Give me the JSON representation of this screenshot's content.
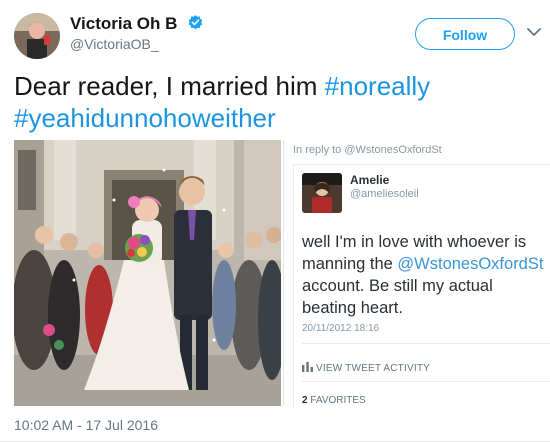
{
  "author": {
    "name": "Victoria Oh B",
    "handle": "@VictoriaOB_"
  },
  "follow_label": "Follow",
  "tweet": {
    "text_prefix": "Dear reader, I married him ",
    "hashtag1": "#noreally",
    "hashtag2": "#yeahidunnohoweither",
    "timestamp": "10:02 AM - 17 Jul 2016"
  },
  "reply": {
    "in_reply_to": "In reply to @WstonesOxfordSt",
    "name": "Amelie",
    "handle": "@ameliesoleil",
    "text_1": "well I'm in love with whoever is manning the ",
    "mention": "@WstonesOxfordSt",
    "text_2": " account. Be still my actual beating heart.",
    "date": "20/11/2012 18:16",
    "activity_label": "VIEW TWEET ACTIVITY",
    "favorites_count": "2",
    "favorites_label": "FAVORITES"
  },
  "colors": {
    "accent": "#1da1f2",
    "hashtag": "#1b95e0"
  },
  "icons": {
    "verified": "verified-badge-icon",
    "chevron": "chevron-down-icon",
    "activity": "bar-chart-icon"
  }
}
